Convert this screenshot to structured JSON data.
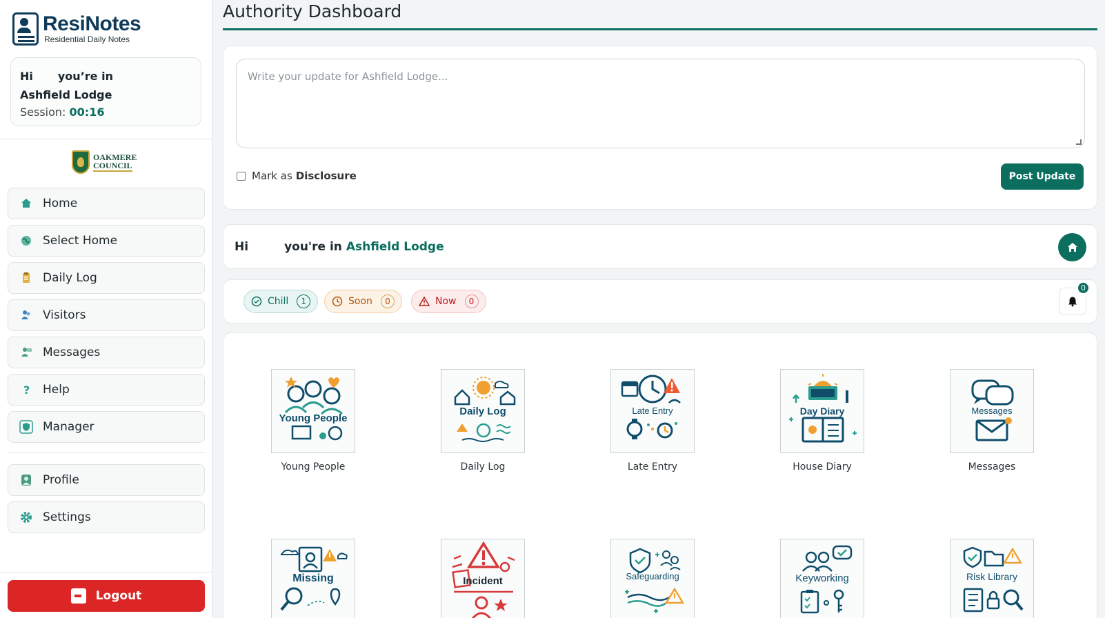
{
  "brand": {
    "name": "ResiNotes",
    "subtitle": "Residential Daily Notes"
  },
  "user_card": {
    "hi": "Hi",
    "in_text": "you’re in",
    "home": "Ashfield Lodge",
    "session_label": "Session:",
    "session_time": "00:16"
  },
  "council": {
    "line1": "OAKMERE",
    "line2": "COUNCIL"
  },
  "sidebar": {
    "items": [
      {
        "label": "Home",
        "icon": "home-icon"
      },
      {
        "label": "Select Home",
        "icon": "globe-icon"
      },
      {
        "label": "Daily Log",
        "icon": "clipboard-icon"
      },
      {
        "label": "Visitors",
        "icon": "visitors-icon"
      },
      {
        "label": "Messages",
        "icon": "messages-icon"
      },
      {
        "label": "Help",
        "icon": "question-icon"
      },
      {
        "label": "Manager",
        "icon": "shield-icon"
      }
    ],
    "secondary": [
      {
        "label": "Profile",
        "icon": "user-icon"
      },
      {
        "label": "Settings",
        "icon": "gear-icon"
      }
    ],
    "logout": "Logout"
  },
  "header": {
    "title": "Authority Dashboard"
  },
  "post": {
    "placeholder": "Write your update for Ashfield Lodge...",
    "mark_as": "Mark as",
    "disclosure": "Disclosure",
    "button": "Post Update"
  },
  "greeting": {
    "hi": "Hi",
    "in_text": "you're in",
    "home": "Ashfield Lodge"
  },
  "status": {
    "chill": {
      "label": "Chill",
      "count": "1"
    },
    "soon": {
      "label": "Soon",
      "count": "0"
    },
    "now": {
      "label": "Now",
      "count": "0"
    },
    "notifications": "0"
  },
  "tiles": [
    {
      "caption": "Young People",
      "art_label": "Young People"
    },
    {
      "caption": "Daily Log",
      "art_label": "Daily Log"
    },
    {
      "caption": "Late Entry",
      "art_label": "Late Entry"
    },
    {
      "caption": "House Diary",
      "art_label": "Day Diary"
    },
    {
      "caption": "Messages",
      "art_label": "Messages"
    },
    {
      "caption": "",
      "art_label": "Missing"
    },
    {
      "caption": "",
      "art_label": "Incident"
    },
    {
      "caption": "",
      "art_label": "Safeguarding"
    },
    {
      "caption": "",
      "art_label": "Keyworking"
    },
    {
      "caption": "",
      "art_label": "Risk Library"
    }
  ],
  "colors": {
    "accent": "#0b6e5f",
    "danger": "#dc2626",
    "brand": "#0f3b5a"
  }
}
